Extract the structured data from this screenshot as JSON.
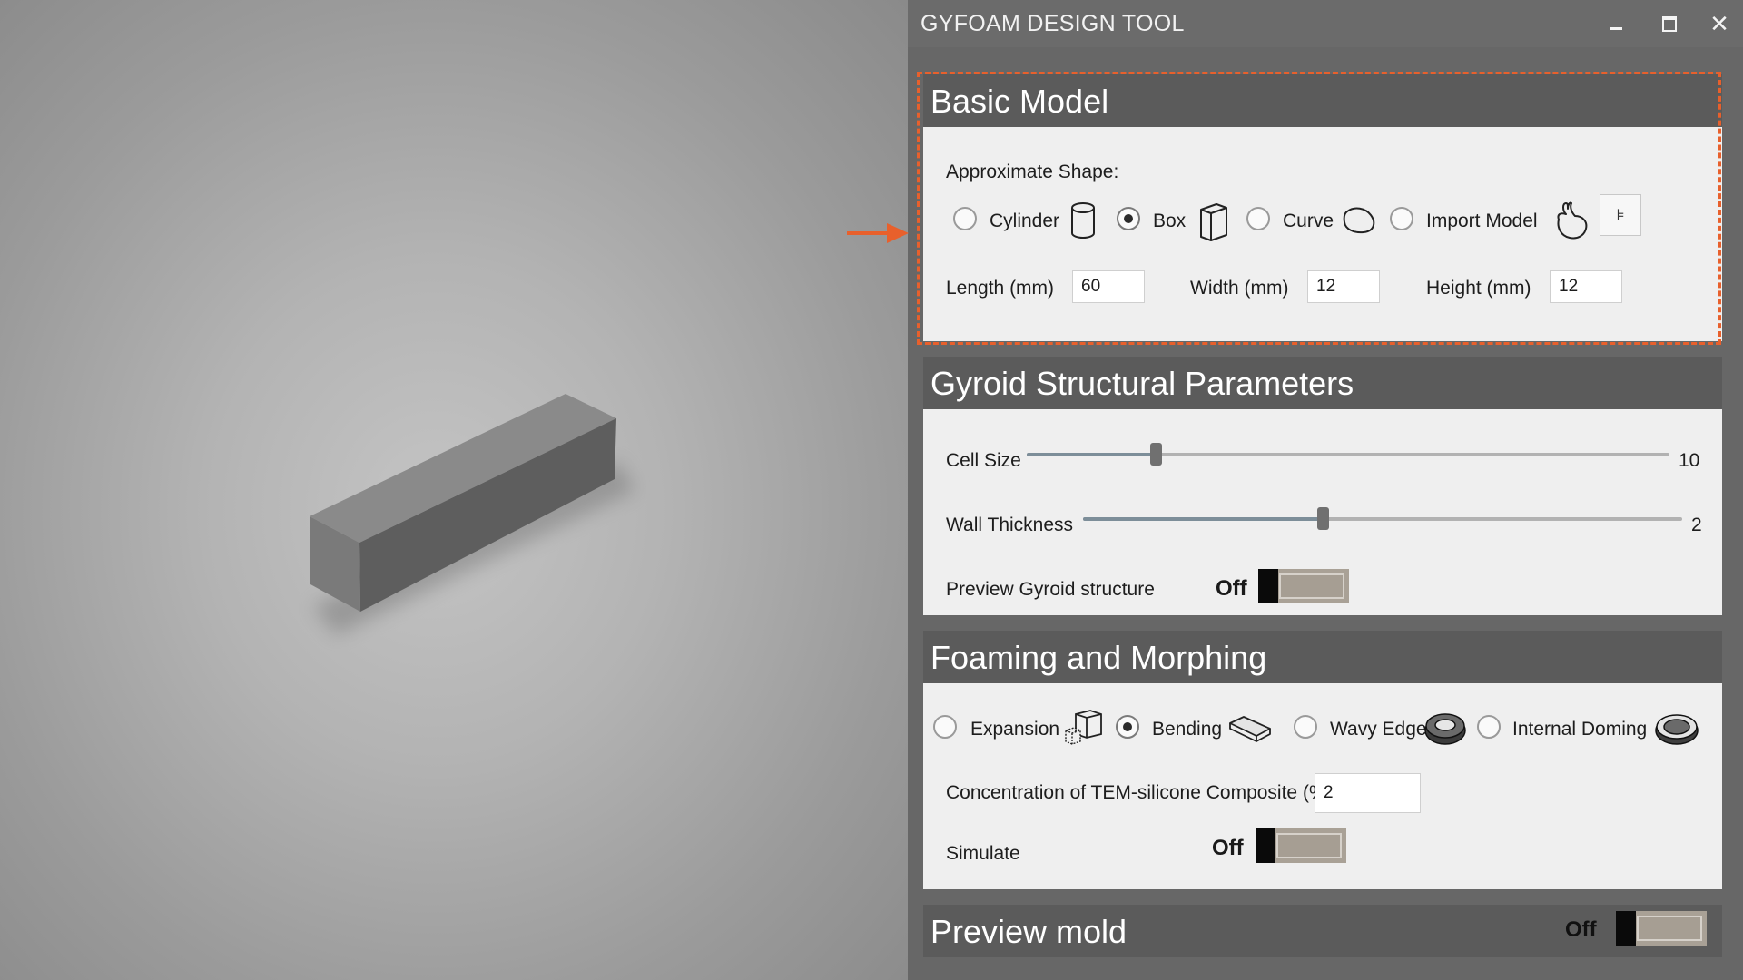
{
  "window": {
    "title": "GYFOAM DESIGN TOOL",
    "minimize_icon": "minimize-icon",
    "maximize_icon": "maximize-icon",
    "close_icon": "close-icon"
  },
  "basic_model": {
    "heading": "Basic Model",
    "shape_label": "Approximate Shape:",
    "shapes": [
      {
        "label": "Cylinder",
        "icon": "cylinder-icon",
        "selected": false
      },
      {
        "label": "Box",
        "icon": "box-icon",
        "selected": true
      },
      {
        "label": "Curve",
        "icon": "curve-icon",
        "selected": false
      },
      {
        "label": "Import Model",
        "icon": "bunny-icon",
        "selected": false
      }
    ],
    "import_button_icon": "open-file-icon",
    "length_label": "Length (mm)",
    "length_value": "60",
    "width_label": "Width (mm)",
    "width_value": "12",
    "height_label": "Height (mm)",
    "height_value": "12"
  },
  "gyroid": {
    "heading": "Gyroid Structural Parameters",
    "cell_size_label": "Cell Size",
    "cell_size_value": "10",
    "cell_size_fraction": 0.2,
    "wall_thickness_label": "Wall Thickness",
    "wall_thickness_value": "2",
    "wall_thickness_fraction": 0.4,
    "preview_label": "Preview Gyroid structure",
    "preview_state": "Off"
  },
  "foaming": {
    "heading": "Foaming and Morphing",
    "modes": [
      {
        "label": "Expansion",
        "icon": "expansion-icon",
        "selected": false
      },
      {
        "label": "Bending",
        "icon": "bending-icon",
        "selected": true
      },
      {
        "label": "Wavy Edges",
        "icon": "wavy-edges-icon",
        "selected": false
      },
      {
        "label": "Internal Doming",
        "icon": "internal-doming-icon",
        "selected": false
      }
    ],
    "concentration_label": "Concentration of TEM-silicone Composite  (%)",
    "concentration_value": "2",
    "simulate_label": "Simulate",
    "simulate_state": "Off"
  },
  "preview_mold": {
    "heading": "Preview mold",
    "state": "Off"
  },
  "colors": {
    "highlight": "#e8602c",
    "section_header": "#5b5b5b",
    "panel_bg": "#efefef"
  }
}
